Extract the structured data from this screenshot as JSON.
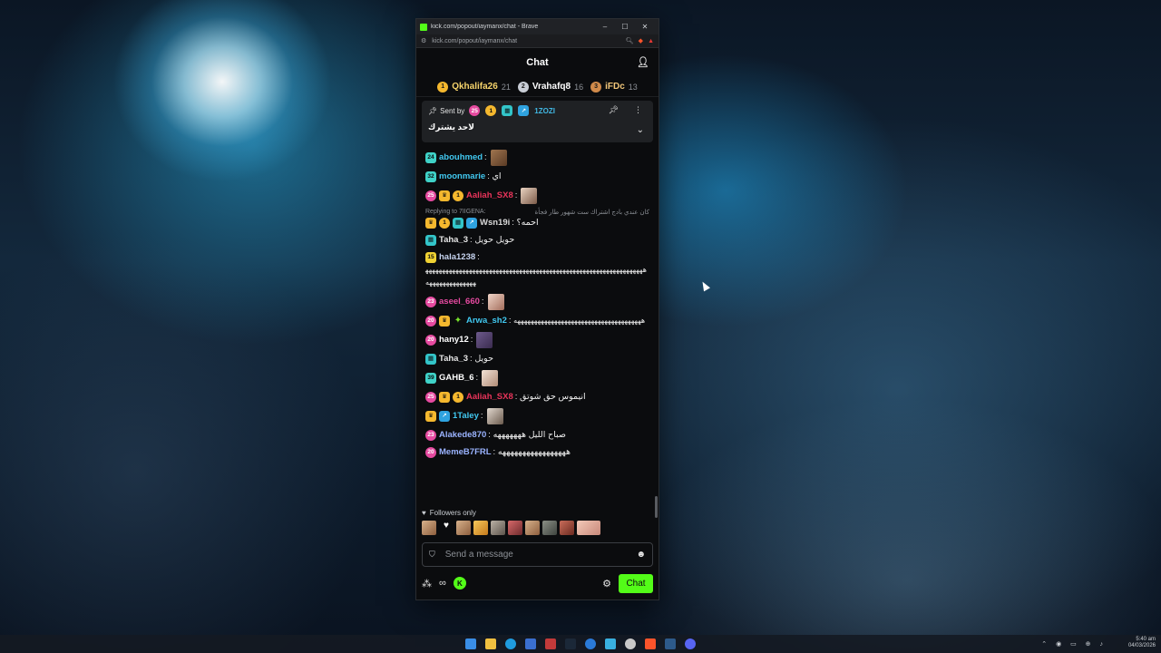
{
  "window": {
    "title": "kick.com/popout/iaymanx/chat - Brave",
    "url": "kick.com/popout/iaymanx/chat",
    "controls": {
      "minimize": "–",
      "maximize": "☐",
      "close": "✕"
    }
  },
  "chat": {
    "header_title": "Chat",
    "leaderboard": [
      {
        "rank": "1",
        "name": "Qkhalifa26",
        "count": "21"
      },
      {
        "rank": "2",
        "name": "Vrahafq8",
        "count": "16"
      },
      {
        "rank": "3",
        "name": "iFDc",
        "count": "13"
      }
    ],
    "pinned": {
      "sent_by_label": "Sent by",
      "pinner": "1ZOZI",
      "message": "لاحد يشترك"
    },
    "messages": [
      {
        "badge": "24",
        "user": "abouhmed",
        "text": ""
      },
      {
        "badge": "32",
        "user": "moonmarie",
        "text": "اي"
      },
      {
        "badge": "25",
        "user": "Aaliah_SX8",
        "text": ""
      },
      {
        "reply_to": "Replying to 7IIGENA:",
        "reply_text": "كان عندي بادج اشتراك ست شهور طار فجأة",
        "user": "Wsn19i",
        "text": "احمه؟"
      },
      {
        "user": "Taha_3",
        "text": "حويل حويل"
      },
      {
        "badge": "15",
        "user": "hala1238",
        "text": "ههههههههههههههههههههههههههههههههههههههههههههههههههههههههههههههههههههههههههههههههه"
      },
      {
        "badge": "23",
        "user": "aseel_660",
        "text": ""
      },
      {
        "badge": "20",
        "user": "Arwa_sh2",
        "text": "ههههههههههههههههههههههههههههههههههههههه"
      },
      {
        "badge": "20",
        "user": "hany12",
        "text": ""
      },
      {
        "user": "Taha_3",
        "text": "حويل"
      },
      {
        "badge": "39",
        "user": "GAHB_6",
        "text": ""
      },
      {
        "badge": "25",
        "user": "Aaliah_SX8",
        "text": "انيموس حق شوتق"
      },
      {
        "user": "1Taley",
        "text": ""
      },
      {
        "badge": "23",
        "user": "Alakede870",
        "text": "صباح الليل هههههههه"
      },
      {
        "badge": "20",
        "user": "MemeB7FRL",
        "text": "هههههههههههههههههه"
      }
    ],
    "followers_only": "Followers only",
    "composer_placeholder": "Send a message",
    "send_label": "Chat"
  },
  "taskbar": {
    "time": "5:40 am",
    "date": "04/03/2026"
  },
  "colors": {
    "kick_green": "#53fc18",
    "chat_bg": "#0b0c0e",
    "gold": "#f5b82e"
  },
  "icons": [
    "users-icon",
    "pin-icon",
    "more-icon",
    "chevron-down-icon",
    "shield-icon",
    "smile-icon",
    "settings-icon",
    "kick-icon",
    "infinity-icon"
  ]
}
